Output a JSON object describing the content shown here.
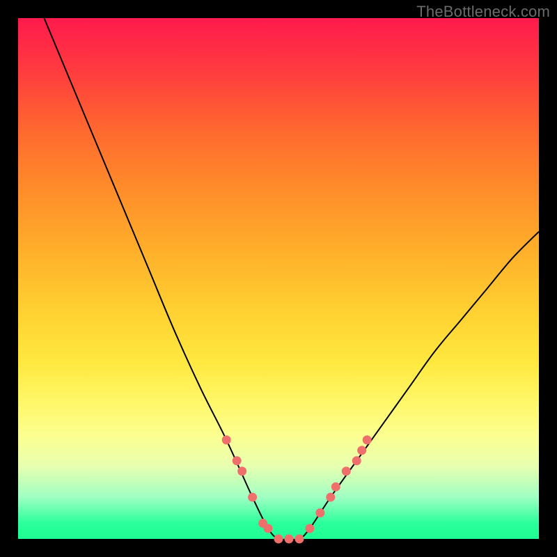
{
  "watermark": "TheBottleneck.com",
  "chart_data": {
    "type": "line",
    "title": "",
    "xlabel": "",
    "ylabel": "",
    "xlim": [
      0,
      100
    ],
    "ylim": [
      0,
      100
    ],
    "series": [
      {
        "name": "bottleneck-curve",
        "x": [
          5,
          10,
          15,
          20,
          25,
          30,
          35,
          40,
          45,
          48,
          50,
          52,
          54,
          56,
          60,
          65,
          70,
          75,
          80,
          85,
          90,
          95,
          100
        ],
        "y": [
          100,
          88,
          76,
          64,
          52,
          40,
          29,
          19,
          8,
          2,
          0,
          0,
          0,
          2,
          8,
          15,
          22,
          29,
          36,
          42,
          48,
          54,
          59
        ]
      }
    ],
    "markers": {
      "name": "highlight-dots",
      "color": "#ee6f6b",
      "x": [
        40,
        42,
        43,
        45,
        47,
        48,
        50,
        52,
        54,
        56,
        58,
        60,
        61,
        63,
        65,
        66,
        67
      ],
      "y": [
        19,
        15,
        13,
        8,
        3,
        2,
        0,
        0,
        0,
        2,
        5,
        8,
        10,
        13,
        15,
        17,
        19
      ]
    }
  }
}
